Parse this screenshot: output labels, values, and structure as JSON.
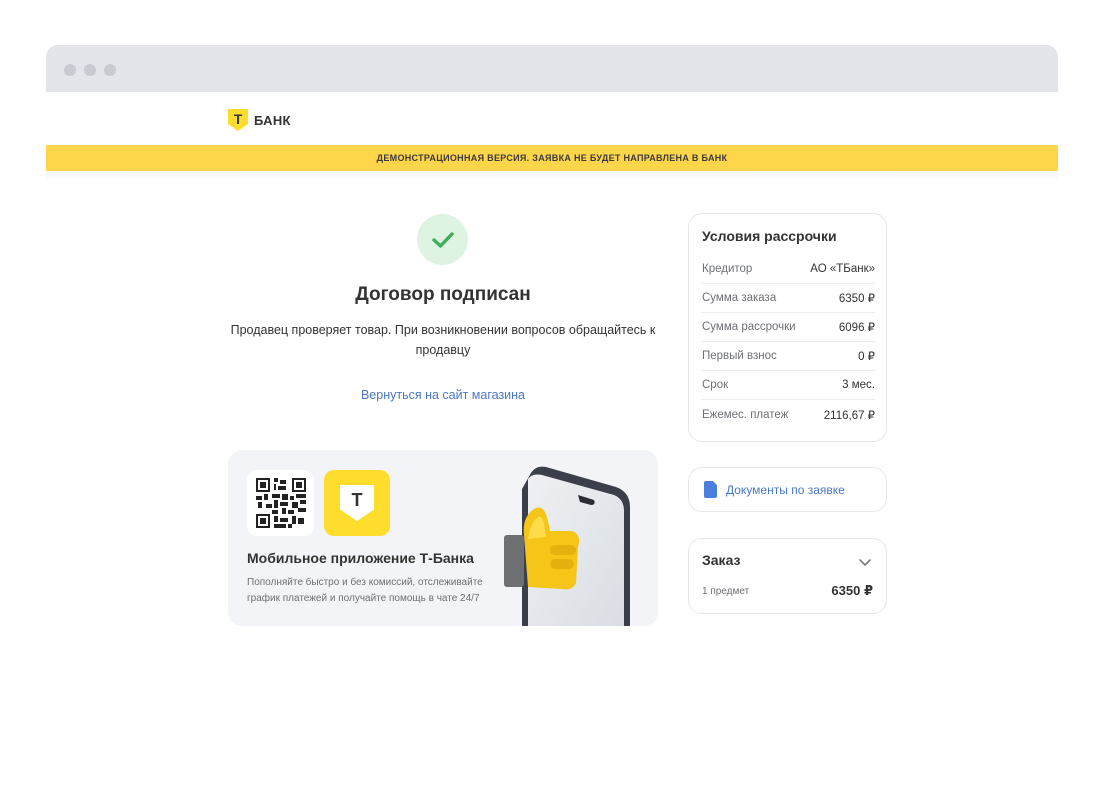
{
  "header": {
    "logo_letter": "Т",
    "logo_text": "БАНК"
  },
  "demo_banner": "ДЕМОНСТРАЦИОННАЯ ВЕРСИЯ. ЗАЯВКА НЕ БУДЕТ НАПРАВЛЕНА В БАНК",
  "main": {
    "title": "Договор подписан",
    "subtitle": "Продавец проверяет товар. При возникновении вопросов обращайтесь к продавцу",
    "back_link": "Вернуться на сайт магазина"
  },
  "promo": {
    "app_letter": "Т",
    "title": "Мобильное приложение Т-Банка",
    "text": "Пополняйте быстро и без комиссий, отслеживайте график платежей и получайте помощь в чате 24/7"
  },
  "terms": {
    "title": "Условия рассрочки",
    "rows": [
      {
        "label": "Кредитор",
        "value": "АО «ТБанк»"
      },
      {
        "label": "Сумма заказа",
        "value": "6350 ₽"
      },
      {
        "label": "Сумма рассрочки",
        "value": "6096 ₽"
      },
      {
        "label": "Первый взнос",
        "value": "0 ₽"
      },
      {
        "label": "Срок",
        "value": "3 мес."
      },
      {
        "label": "Ежемес. платеж",
        "value": "2116,67 ₽"
      }
    ]
  },
  "docs": {
    "label": "Документы по заявке"
  },
  "order": {
    "title": "Заказ",
    "count": "1 предмет",
    "sum": "6350 ₽"
  },
  "colors": {
    "brand_yellow": "#ffdd2d",
    "banner_yellow": "#ffd54a",
    "link_blue": "#4a78c8",
    "success_green": "#3fae5a"
  }
}
